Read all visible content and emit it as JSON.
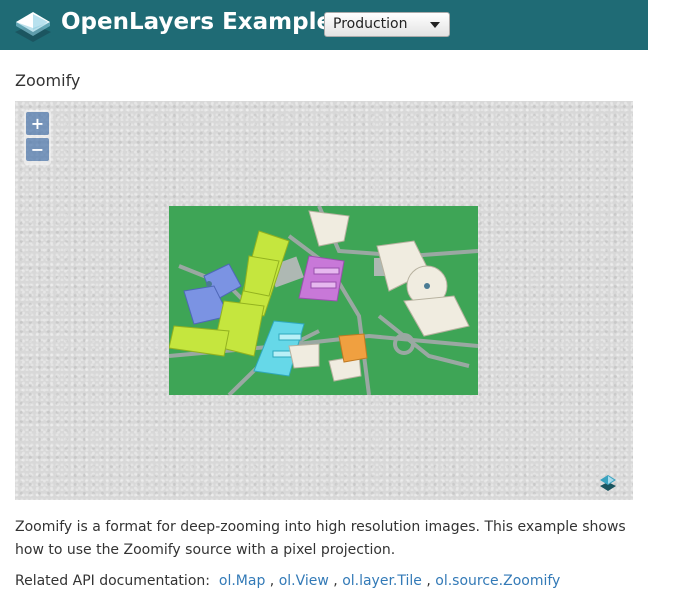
{
  "header": {
    "brand": "OpenLayers Examples",
    "version_select": {
      "value": "Production"
    },
    "color": "#1f6b75"
  },
  "page": {
    "title": "Zoomify"
  },
  "map": {
    "zoom_in_label": "+",
    "zoom_out_label": "−",
    "background": "#d8d8d8",
    "image_background": "#3ea556"
  },
  "description": "Zoomify is a format for deep-zooming into high resolution images. This example shows how to use the Zoomify source with a pixel projection.",
  "related_api": {
    "label": "Related API documentation:",
    "links": [
      "ol.Map",
      "ol.View",
      "ol.layer.Tile",
      "ol.source.Zoomify"
    ],
    "separator": ","
  }
}
